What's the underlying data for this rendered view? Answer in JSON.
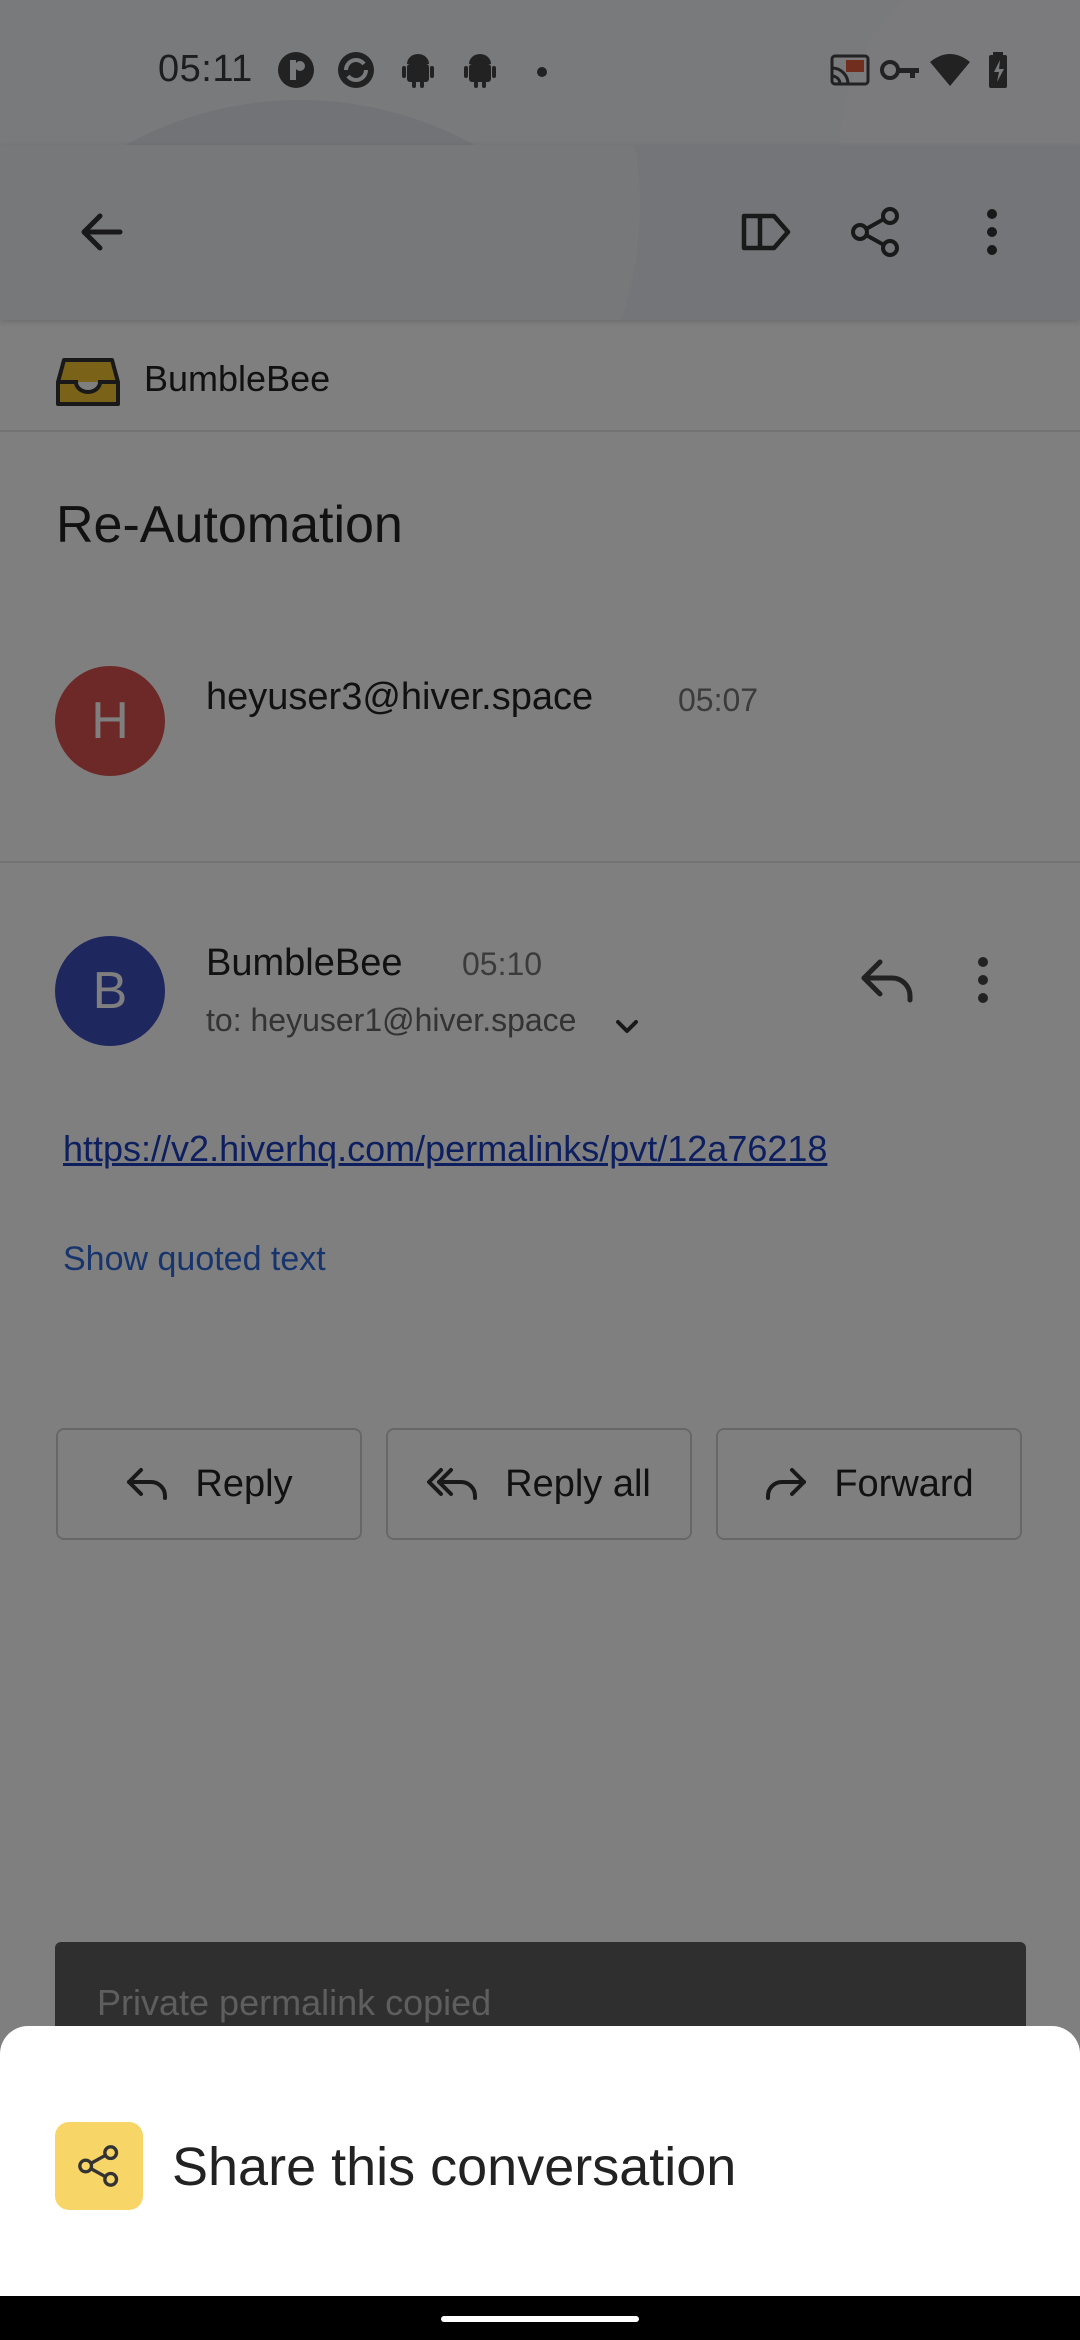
{
  "status_bar": {
    "time": "05:11"
  },
  "toolbar": {
    "icons": [
      "back-arrow-icon",
      "label-icon",
      "share-icon",
      "more-vert-icon"
    ]
  },
  "inbox": {
    "name": "BumbleBee"
  },
  "conversation": {
    "subject": "Re-Automation"
  },
  "messages": [
    {
      "avatar_letter": "H",
      "avatar_color": "#d9534f",
      "from": "heyuser3@hiver.space",
      "time": "05:07"
    },
    {
      "avatar_letter": "B",
      "avatar_color": "#3f4fbf",
      "from": "BumbleBee",
      "time": "05:10",
      "to": "to: heyuser1@hiver.space"
    }
  ],
  "message_body": {
    "link": "https://v2.hiverhq.com/permalinks/pvt/12a76218",
    "show_quoted": "Show quoted text"
  },
  "actions": {
    "reply": "Reply",
    "reply_all": "Reply all",
    "forward": "Forward"
  },
  "snackbar": {
    "text": "Private permalink copied"
  },
  "bottom_sheet": {
    "share_label": "Share this conversation",
    "accent": "#f8d567"
  }
}
